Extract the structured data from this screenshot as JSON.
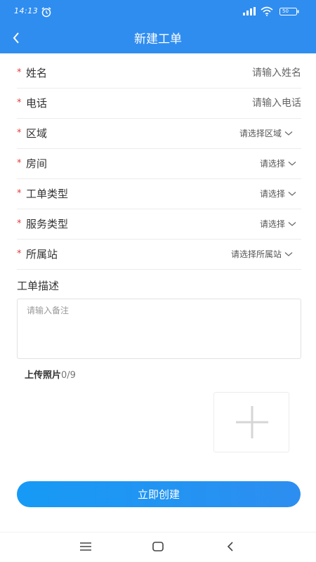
{
  "status_bar": {
    "time": "14:13",
    "battery": "50"
  },
  "header": {
    "title": "新建工单"
  },
  "form": {
    "name": {
      "label": "姓名",
      "placeholder": "请输入姓名"
    },
    "phone": {
      "label": "电话",
      "placeholder": "请输入电话"
    },
    "area": {
      "label": "区域",
      "value": "请选择区域"
    },
    "room": {
      "label": "房间",
      "value": "请选择"
    },
    "order_type": {
      "label": "工单类型",
      "value": "请选择"
    },
    "service_type": {
      "label": "服务类型",
      "value": "请选择"
    },
    "station": {
      "label": "所属站",
      "value": "请选择所属站"
    },
    "required_mark": "*",
    "description": {
      "label": "工单描述",
      "placeholder": "请输入备注"
    },
    "upload": {
      "label": "上传照片",
      "count": "0/9"
    }
  },
  "actions": {
    "create_label": "立即创建"
  },
  "colors": {
    "primary": "#2f8df0",
    "required": "#e23c3c"
  },
  "icons": {
    "back": "chevron-left-icon",
    "add": "plus-icon",
    "dropdown": "chevron-down-icon"
  }
}
